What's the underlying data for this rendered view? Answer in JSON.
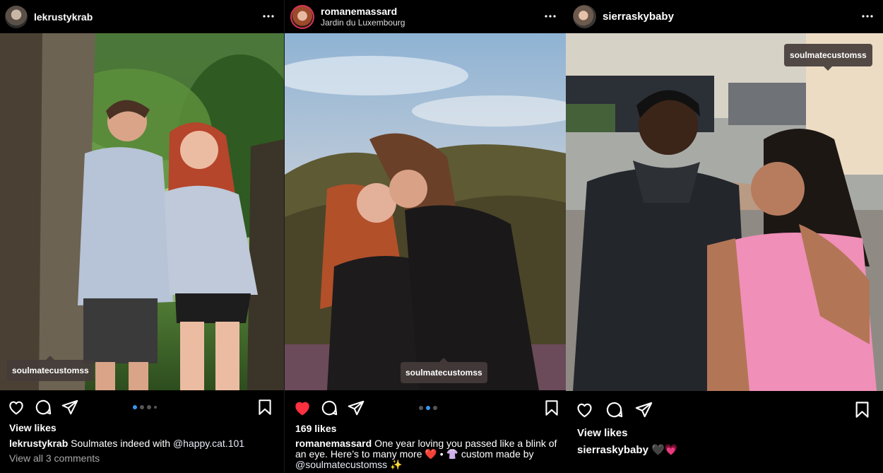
{
  "posts": [
    {
      "username": "lekrustykrab",
      "tag": "soulmatecustomss",
      "likes_label": "View likes",
      "caption_user": "lekrustykrab",
      "caption_text": "Soulmates indeed with",
      "caption_mention": "@happy.cat.101",
      "comments_label": "View all 3 comments",
      "liked": false
    },
    {
      "username": "romanemassard",
      "location": "Jardin du Luxembourg",
      "tag": "soulmatecustomss",
      "likes_label": "169 likes",
      "caption_user": "romanemassard",
      "caption_text": "One year loving you passed like a blink of an eye. Here’s to many more ❤️ • 👚 custom made by",
      "caption_mention": "@soulmatecustomss",
      "caption_end": "✨",
      "liked": true
    },
    {
      "username": "sierraskybaby",
      "tag": "soulmatecustomss",
      "likes_label": "View likes",
      "caption_user": "sierraskybaby",
      "caption_text": "🖤💗",
      "liked": false
    }
  ],
  "icons": [
    "more-icon",
    "heart-icon",
    "comment-icon",
    "share-icon",
    "bookmark-icon"
  ],
  "colors": {
    "background": "#000000",
    "like_red": "#ff3040",
    "carousel_active": "#3897f0"
  }
}
